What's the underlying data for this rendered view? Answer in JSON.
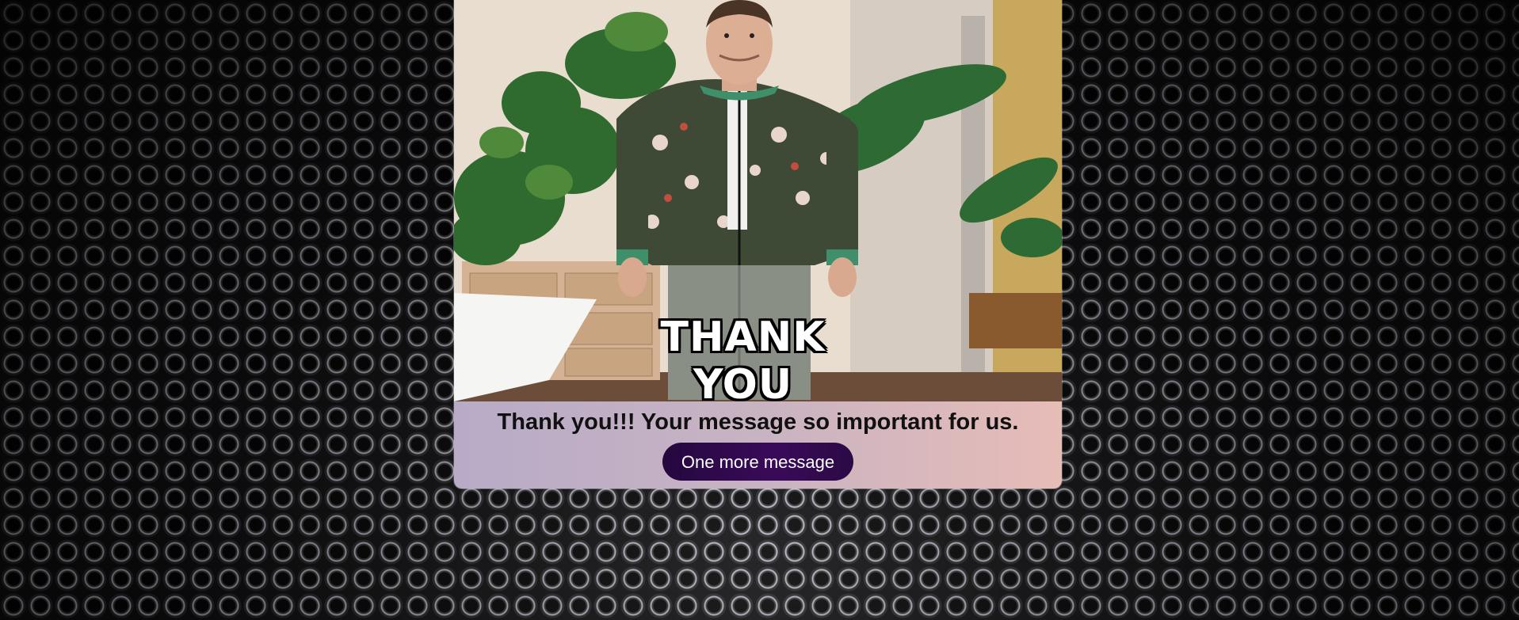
{
  "card": {
    "image_caption": "THANK YOU",
    "message": "Thank you!!! Your message so important for us.",
    "button_label": "One more message"
  },
  "colors": {
    "button_bg": "#2d0a4a",
    "card_gradient_start": "#b8abc7",
    "card_gradient_end": "#e7bcb7",
    "background": "#1b1b1d"
  }
}
